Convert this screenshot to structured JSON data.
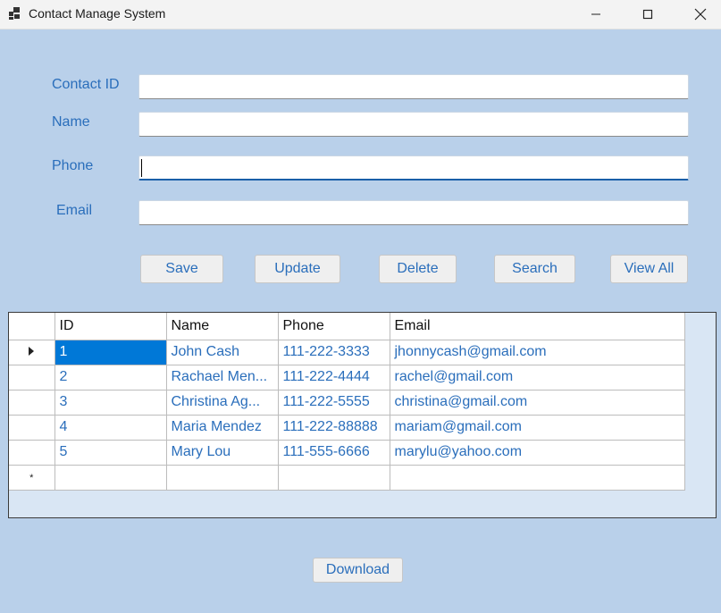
{
  "window": {
    "title": "Contact Manage System",
    "icons": {
      "app": "app-icon",
      "minimize": "minimize-icon",
      "maximize": "maximize-icon",
      "close": "close-icon"
    }
  },
  "form": {
    "contact_id_label": "Contact ID",
    "name_label": "Name",
    "phone_label": "Phone",
    "email_label": "Email",
    "contact_id_value": "",
    "name_value": "",
    "phone_value": "",
    "email_value": ""
  },
  "buttons": {
    "save": "Save",
    "update": "Update",
    "delete": "Delete",
    "search": "Search",
    "view_all": "View All",
    "download": "Download"
  },
  "grid": {
    "columns": [
      "ID",
      "Name",
      "Phone",
      "Email"
    ],
    "rows": [
      [
        "1",
        "John Cash",
        "111-222-3333",
        "jhonnycash@gmail.com"
      ],
      [
        "2",
        "Rachael Men...",
        "111-222-4444",
        "rachel@gmail.com"
      ],
      [
        "3",
        "Christina Ag...",
        "111-222-5555",
        "christina@gmail.com"
      ],
      [
        "4",
        "Maria Mendez",
        "111-222-88888",
        "mariam@gmail.com"
      ],
      [
        "5",
        "Mary Lou",
        "111-555-6666",
        "marylu@yahoo.com"
      ]
    ],
    "new_row_marker": "*"
  },
  "colors": {
    "background": "#b9d0ea",
    "accent_text": "#2a6ebb",
    "selection": "#0078d7"
  }
}
